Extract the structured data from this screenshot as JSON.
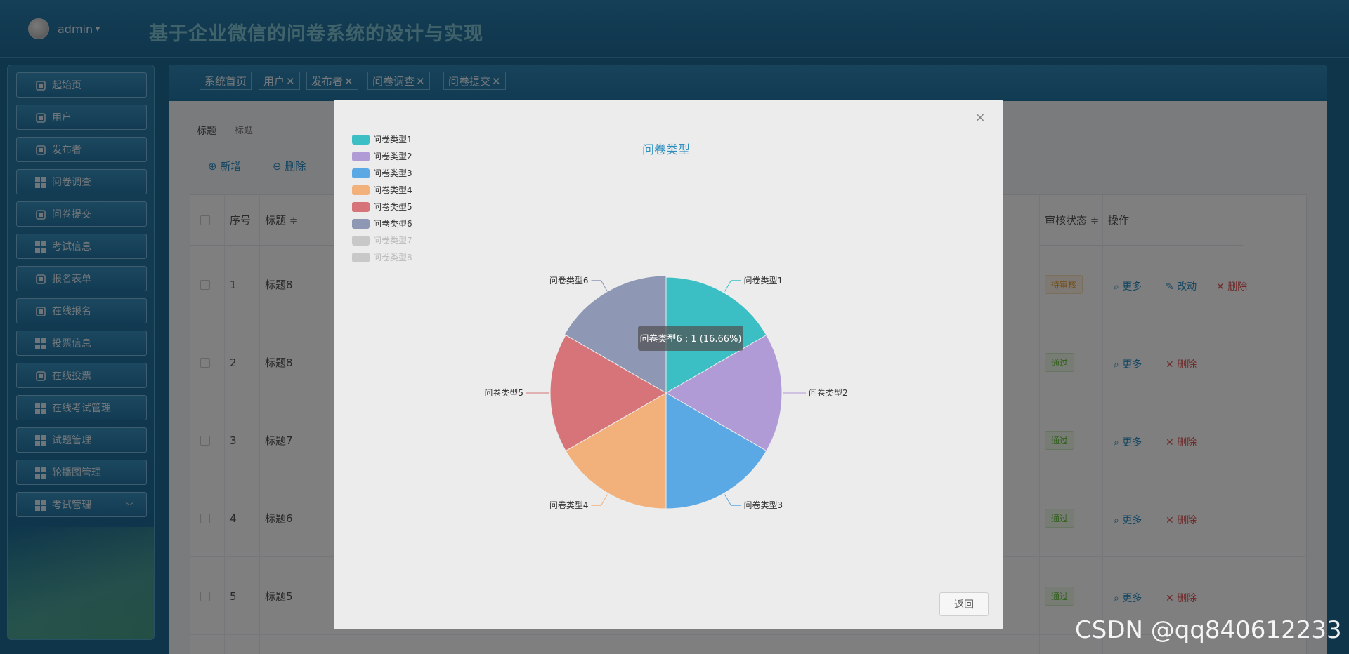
{
  "header": {
    "user_name": "admin",
    "user_caret": "▾",
    "title": "基于企业微信的问卷系统的设计与实现"
  },
  "sidebar": {
    "items": [
      {
        "label": "起始页",
        "icon": "home-icon"
      },
      {
        "label": "用户",
        "icon": "user-doc-icon"
      },
      {
        "label": "发布者",
        "icon": "monitor-icon"
      },
      {
        "label": "问卷调查",
        "icon": "grid-icon"
      },
      {
        "label": "问卷提交",
        "icon": "clipboard-check-icon"
      },
      {
        "label": "考试信息",
        "icon": "grid-icon"
      },
      {
        "label": "报名表单",
        "icon": "person-icon"
      },
      {
        "label": "在线报名",
        "icon": "paper-plane-icon"
      },
      {
        "label": "投票信息",
        "icon": "grid-icon"
      },
      {
        "label": "在线投票",
        "icon": "line-chart-icon"
      },
      {
        "label": "在线考试管理",
        "icon": "grid-icon"
      },
      {
        "label": "试题管理",
        "icon": "grid-icon"
      },
      {
        "label": "轮播图管理",
        "icon": "grid-icon"
      },
      {
        "label": "考试管理",
        "icon": "grid-icon",
        "chevron": "﹀"
      }
    ]
  },
  "tabs": [
    {
      "label": "系统首页",
      "close": ""
    },
    {
      "label": "用户",
      "close": "✕"
    },
    {
      "label": "发布者",
      "close": "✕"
    },
    {
      "label": "问卷调查",
      "close": "✕"
    },
    {
      "label": "问卷提交",
      "close": "✕"
    }
  ],
  "search": {
    "label": "标题",
    "placeholder": "标题"
  },
  "toolbar": {
    "add_label": "⊕ 新增",
    "delete_label": "⊖ 删除"
  },
  "table": {
    "headers": {
      "index": "序号",
      "title": "标题 ≑",
      "status": "审核状态 ≑",
      "ops": "操作"
    },
    "rows": [
      {
        "index": "1",
        "title": "标题8",
        "status": "待审核",
        "status_type": "pending",
        "ops": [
          "更多",
          "改动",
          "删除"
        ]
      },
      {
        "index": "2",
        "title": "标题8",
        "status": "通过",
        "status_type": "pass",
        "ops": [
          "更多",
          "删除"
        ]
      },
      {
        "index": "3",
        "title": "标题7",
        "status": "通过",
        "status_type": "pass",
        "ops": [
          "更多",
          "删除"
        ]
      },
      {
        "index": "4",
        "title": "标题6",
        "status": "通过",
        "status_type": "pass",
        "ops": [
          "更多",
          "删除"
        ]
      },
      {
        "index": "5",
        "title": "标题5",
        "status": "通过",
        "status_type": "pass",
        "ops": [
          "更多",
          "删除"
        ]
      }
    ]
  },
  "dialog": {
    "close": "×",
    "back_label": "返回"
  },
  "chart_data": {
    "type": "pie",
    "title": "问卷类型",
    "categories": [
      "问卷类型1",
      "问卷类型2",
      "问卷类型3",
      "问卷类型4",
      "问卷类型5",
      "问卷类型6",
      "问卷类型7",
      "问卷类型8"
    ],
    "values": [
      1,
      1,
      1,
      1,
      1,
      1,
      0,
      0
    ],
    "colors": [
      "#3bbfc4",
      "#b09bd6",
      "#5aa9e4",
      "#f2b07a",
      "#d67479",
      "#8e97b3",
      "#c8c8c8",
      "#c8c8c8"
    ],
    "legend_disabled": [
      "问卷类型7",
      "问卷类型8"
    ],
    "legend": "top-left",
    "tooltip": "问卷类型6 : 1 (16.66%)"
  },
  "watermark": "CSDN @qq840612233"
}
